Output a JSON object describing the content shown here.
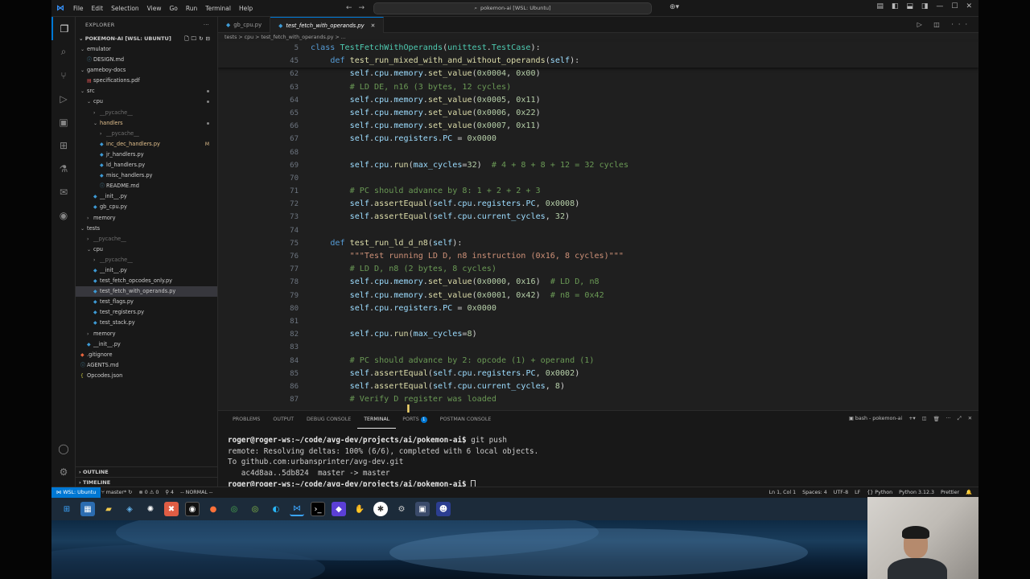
{
  "window": {
    "menu": [
      "File",
      "Edit",
      "Selection",
      "View",
      "Go",
      "Run",
      "Terminal",
      "Help"
    ],
    "command_center": "pokemon-ai [WSL: Ubuntu]"
  },
  "explorer": {
    "title": "EXPLORER",
    "root": "POKEMON-AI [WSL: UBUNTU]",
    "tree": [
      {
        "label": "emulator",
        "depth": 0,
        "type": "folder-open"
      },
      {
        "label": "DESIGN.md",
        "depth": 1,
        "type": "md"
      },
      {
        "label": "gameboy-docs",
        "depth": 0,
        "type": "folder-open"
      },
      {
        "label": "specifications.pdf",
        "depth": 1,
        "type": "pdf"
      },
      {
        "label": "src",
        "depth": 0,
        "type": "folder-open",
        "dot": true
      },
      {
        "label": "cpu",
        "depth": 1,
        "type": "folder-open",
        "dot": true
      },
      {
        "label": "__pycache__",
        "depth": 2,
        "type": "folder",
        "dim": true
      },
      {
        "label": "handlers",
        "depth": 2,
        "type": "folder-open",
        "mod": true,
        "dot": true
      },
      {
        "label": "__pycache__",
        "depth": 3,
        "type": "folder",
        "dim": true
      },
      {
        "label": "inc_dec_handlers.py",
        "depth": 3,
        "type": "py",
        "mod": true,
        "badge": "M"
      },
      {
        "label": "jr_handlers.py",
        "depth": 3,
        "type": "py"
      },
      {
        "label": "ld_handlers.py",
        "depth": 3,
        "type": "py"
      },
      {
        "label": "misc_handlers.py",
        "depth": 3,
        "type": "py"
      },
      {
        "label": "README.md",
        "depth": 3,
        "type": "md"
      },
      {
        "label": "__init__.py",
        "depth": 2,
        "type": "py"
      },
      {
        "label": "gb_cpu.py",
        "depth": 2,
        "type": "py"
      },
      {
        "label": "memory",
        "depth": 1,
        "type": "folder"
      },
      {
        "label": "tests",
        "depth": 0,
        "type": "folder-open"
      },
      {
        "label": "__pycache__",
        "depth": 1,
        "type": "folder",
        "dim": true
      },
      {
        "label": "cpu",
        "depth": 1,
        "type": "folder-open"
      },
      {
        "label": "__pycache__",
        "depth": 2,
        "type": "folder",
        "dim": true
      },
      {
        "label": "__init__.py",
        "depth": 2,
        "type": "py"
      },
      {
        "label": "test_fetch_opcodes_only.py",
        "depth": 2,
        "type": "py"
      },
      {
        "label": "test_fetch_with_operands.py",
        "depth": 2,
        "type": "py",
        "selected": true
      },
      {
        "label": "test_flags.py",
        "depth": 2,
        "type": "py"
      },
      {
        "label": "test_registers.py",
        "depth": 2,
        "type": "py"
      },
      {
        "label": "test_stack.py",
        "depth": 2,
        "type": "py"
      },
      {
        "label": "memory",
        "depth": 1,
        "type": "folder"
      },
      {
        "label": "__init__.py",
        "depth": 1,
        "type": "py"
      },
      {
        "label": ".gitignore",
        "depth": 0,
        "type": "git"
      },
      {
        "label": "AGENTS.md",
        "depth": 0,
        "type": "md"
      },
      {
        "label": "Opcodes.json",
        "depth": 0,
        "type": "json"
      }
    ],
    "outline": "OUTLINE",
    "timeline": "TIMELINE"
  },
  "editor": {
    "tabs": [
      {
        "label": "gb_cpu.py",
        "active": false
      },
      {
        "label": "test_fetch_with_operands.py",
        "active": true
      }
    ],
    "breadcrumb": "tests > cpu > test_fetch_with_operands.py > ...",
    "sticky": [
      {
        "n": "5",
        "tokens": [
          [
            "kw",
            "class "
          ],
          [
            "cls",
            "TestFetchWithOperands"
          ],
          [
            "op",
            "("
          ],
          [
            "cls",
            "unittest"
          ],
          [
            "op",
            "."
          ],
          [
            "cls",
            "TestCase"
          ],
          [
            "op",
            "):"
          ]
        ]
      },
      {
        "n": "45",
        "tokens": [
          [
            "op",
            "    "
          ],
          [
            "kw",
            "def "
          ],
          [
            "fn",
            "test_run_mixed_with_and_without_operands"
          ],
          [
            "op",
            "("
          ],
          [
            "slf",
            "self"
          ],
          [
            "op",
            "):"
          ]
        ]
      }
    ],
    "lines": [
      {
        "n": "62",
        "tokens": [
          [
            "op",
            "        "
          ],
          [
            "slf",
            "self"
          ],
          [
            "op",
            "."
          ],
          [
            "var",
            "cpu"
          ],
          [
            "op",
            "."
          ],
          [
            "var",
            "memory"
          ],
          [
            "op",
            "."
          ],
          [
            "fn",
            "set_value"
          ],
          [
            "op",
            "("
          ],
          [
            "num",
            "0x0004"
          ],
          [
            "op",
            ", "
          ],
          [
            "num",
            "0x00"
          ],
          [
            "op",
            ")"
          ]
        ]
      },
      {
        "n": "63",
        "tokens": [
          [
            "cmt",
            "        # LD DE, n16 (3 bytes, 12 cycles)"
          ]
        ]
      },
      {
        "n": "64",
        "tokens": [
          [
            "op",
            "        "
          ],
          [
            "slf",
            "self"
          ],
          [
            "op",
            "."
          ],
          [
            "var",
            "cpu"
          ],
          [
            "op",
            "."
          ],
          [
            "var",
            "memory"
          ],
          [
            "op",
            "."
          ],
          [
            "fn",
            "set_value"
          ],
          [
            "op",
            "("
          ],
          [
            "num",
            "0x0005"
          ],
          [
            "op",
            ", "
          ],
          [
            "num",
            "0x11"
          ],
          [
            "op",
            ")"
          ]
        ]
      },
      {
        "n": "65",
        "tokens": [
          [
            "op",
            "        "
          ],
          [
            "slf",
            "self"
          ],
          [
            "op",
            "."
          ],
          [
            "var",
            "cpu"
          ],
          [
            "op",
            "."
          ],
          [
            "var",
            "memory"
          ],
          [
            "op",
            "."
          ],
          [
            "fn",
            "set_value"
          ],
          [
            "op",
            "("
          ],
          [
            "num",
            "0x0006"
          ],
          [
            "op",
            ", "
          ],
          [
            "num",
            "0x22"
          ],
          [
            "op",
            ")"
          ]
        ]
      },
      {
        "n": "66",
        "tokens": [
          [
            "op",
            "        "
          ],
          [
            "slf",
            "self"
          ],
          [
            "op",
            "."
          ],
          [
            "var",
            "cpu"
          ],
          [
            "op",
            "."
          ],
          [
            "var",
            "memory"
          ],
          [
            "op",
            "."
          ],
          [
            "fn",
            "set_value"
          ],
          [
            "op",
            "("
          ],
          [
            "num",
            "0x0007"
          ],
          [
            "op",
            ", "
          ],
          [
            "num",
            "0x11"
          ],
          [
            "op",
            ")"
          ]
        ]
      },
      {
        "n": "67",
        "tokens": [
          [
            "op",
            "        "
          ],
          [
            "slf",
            "self"
          ],
          [
            "op",
            "."
          ],
          [
            "var",
            "cpu"
          ],
          [
            "op",
            "."
          ],
          [
            "var",
            "registers"
          ],
          [
            "op",
            "."
          ],
          [
            "var",
            "PC"
          ],
          [
            "op",
            " = "
          ],
          [
            "num",
            "0x0000"
          ]
        ]
      },
      {
        "n": "68",
        "tokens": []
      },
      {
        "n": "69",
        "tokens": [
          [
            "op",
            "        "
          ],
          [
            "slf",
            "self"
          ],
          [
            "op",
            "."
          ],
          [
            "var",
            "cpu"
          ],
          [
            "op",
            "."
          ],
          [
            "fn",
            "run"
          ],
          [
            "op",
            "("
          ],
          [
            "prm",
            "max_cycles"
          ],
          [
            "op",
            "="
          ],
          [
            "num",
            "32"
          ],
          [
            "op",
            ")  "
          ],
          [
            "cmt",
            "# 4 + 8 + 8 + 12 = 32 cycles"
          ]
        ]
      },
      {
        "n": "70",
        "tokens": []
      },
      {
        "n": "71",
        "tokens": [
          [
            "cmt",
            "        # PC should advance by 8: 1 + 2 + 2 + 3"
          ]
        ]
      },
      {
        "n": "72",
        "tokens": [
          [
            "op",
            "        "
          ],
          [
            "slf",
            "self"
          ],
          [
            "op",
            "."
          ],
          [
            "fn",
            "assertEqual"
          ],
          [
            "op",
            "("
          ],
          [
            "slf",
            "self"
          ],
          [
            "op",
            "."
          ],
          [
            "var",
            "cpu"
          ],
          [
            "op",
            "."
          ],
          [
            "var",
            "registers"
          ],
          [
            "op",
            "."
          ],
          [
            "var",
            "PC"
          ],
          [
            "op",
            ", "
          ],
          [
            "num",
            "0x0008"
          ],
          [
            "op",
            ")"
          ]
        ]
      },
      {
        "n": "73",
        "tokens": [
          [
            "op",
            "        "
          ],
          [
            "slf",
            "self"
          ],
          [
            "op",
            "."
          ],
          [
            "fn",
            "assertEqual"
          ],
          [
            "op",
            "("
          ],
          [
            "slf",
            "self"
          ],
          [
            "op",
            "."
          ],
          [
            "var",
            "cpu"
          ],
          [
            "op",
            "."
          ],
          [
            "var",
            "current_cycles"
          ],
          [
            "op",
            ", "
          ],
          [
            "num",
            "32"
          ],
          [
            "op",
            ")"
          ]
        ]
      },
      {
        "n": "74",
        "tokens": []
      },
      {
        "n": "75",
        "tokens": [
          [
            "op",
            "    "
          ],
          [
            "kw",
            "def "
          ],
          [
            "fn",
            "test_run_ld_d_n8"
          ],
          [
            "op",
            "("
          ],
          [
            "slf",
            "self"
          ],
          [
            "op",
            "):"
          ]
        ]
      },
      {
        "n": "76",
        "tokens": [
          [
            "str",
            "        \"\"\"Test running LD D, n8 instruction (0x16, 8 cycles)\"\"\""
          ]
        ]
      },
      {
        "n": "77",
        "tokens": [
          [
            "cmt",
            "        # LD D, n8 (2 bytes, 8 cycles)"
          ]
        ]
      },
      {
        "n": "78",
        "tokens": [
          [
            "op",
            "        "
          ],
          [
            "slf",
            "self"
          ],
          [
            "op",
            "."
          ],
          [
            "var",
            "cpu"
          ],
          [
            "op",
            "."
          ],
          [
            "var",
            "memory"
          ],
          [
            "op",
            "."
          ],
          [
            "fn",
            "set_value"
          ],
          [
            "op",
            "("
          ],
          [
            "num",
            "0x0000"
          ],
          [
            "op",
            ", "
          ],
          [
            "num",
            "0x16"
          ],
          [
            "op",
            ")  "
          ],
          [
            "cmt",
            "# LD D, n8"
          ]
        ]
      },
      {
        "n": "79",
        "tokens": [
          [
            "op",
            "        "
          ],
          [
            "slf",
            "self"
          ],
          [
            "op",
            "."
          ],
          [
            "var",
            "cpu"
          ],
          [
            "op",
            "."
          ],
          [
            "var",
            "memory"
          ],
          [
            "op",
            "."
          ],
          [
            "fn",
            "set_value"
          ],
          [
            "op",
            "("
          ],
          [
            "num",
            "0x0001"
          ],
          [
            "op",
            ", "
          ],
          [
            "num",
            "0x42"
          ],
          [
            "op",
            ")  "
          ],
          [
            "cmt",
            "# n8 = 0x42"
          ]
        ]
      },
      {
        "n": "80",
        "tokens": [
          [
            "op",
            "        "
          ],
          [
            "slf",
            "self"
          ],
          [
            "op",
            "."
          ],
          [
            "var",
            "cpu"
          ],
          [
            "op",
            "."
          ],
          [
            "var",
            "registers"
          ],
          [
            "op",
            "."
          ],
          [
            "var",
            "PC"
          ],
          [
            "op",
            " = "
          ],
          [
            "num",
            "0x0000"
          ]
        ]
      },
      {
        "n": "81",
        "tokens": []
      },
      {
        "n": "82",
        "tokens": [
          [
            "op",
            "        "
          ],
          [
            "slf",
            "self"
          ],
          [
            "op",
            "."
          ],
          [
            "var",
            "cpu"
          ],
          [
            "op",
            "."
          ],
          [
            "fn",
            "run"
          ],
          [
            "op",
            "("
          ],
          [
            "prm",
            "max_cycles"
          ],
          [
            "op",
            "="
          ],
          [
            "num",
            "8"
          ],
          [
            "op",
            ")"
          ]
        ]
      },
      {
        "n": "83",
        "tokens": []
      },
      {
        "n": "84",
        "tokens": [
          [
            "cmt",
            "        # PC should advance by 2: opcode (1) + operand (1)"
          ]
        ]
      },
      {
        "n": "85",
        "tokens": [
          [
            "op",
            "        "
          ],
          [
            "slf",
            "self"
          ],
          [
            "op",
            "."
          ],
          [
            "fn",
            "assertEqual"
          ],
          [
            "op",
            "("
          ],
          [
            "slf",
            "self"
          ],
          [
            "op",
            "."
          ],
          [
            "var",
            "cpu"
          ],
          [
            "op",
            "."
          ],
          [
            "var",
            "registers"
          ],
          [
            "op",
            "."
          ],
          [
            "var",
            "PC"
          ],
          [
            "op",
            ", "
          ],
          [
            "num",
            "0x0002"
          ],
          [
            "op",
            ")"
          ]
        ]
      },
      {
        "n": "86",
        "tokens": [
          [
            "op",
            "        "
          ],
          [
            "slf",
            "self"
          ],
          [
            "op",
            "."
          ],
          [
            "fn",
            "assertEqual"
          ],
          [
            "op",
            "("
          ],
          [
            "slf",
            "self"
          ],
          [
            "op",
            "."
          ],
          [
            "var",
            "cpu"
          ],
          [
            "op",
            "."
          ],
          [
            "var",
            "current_cycles"
          ],
          [
            "op",
            ", "
          ],
          [
            "num",
            "8"
          ],
          [
            "op",
            ")"
          ]
        ]
      },
      {
        "n": "87",
        "tokens": [
          [
            "cmt",
            "        # Verify D register was loaded"
          ]
        ]
      }
    ]
  },
  "panel": {
    "tabs": [
      "PROBLEMS",
      "OUTPUT",
      "DEBUG CONSOLE",
      "TERMINAL",
      "PORTS",
      "POSTMAN CONSOLE"
    ],
    "active_tab": "TERMINAL",
    "ports_badge": "1",
    "terminal_name": "bash - pokemon-ai",
    "lines": [
      {
        "prompt": "roger@roger-ws:~/code/avg-dev/projects/ai/pokemon-ai$",
        "text": " git push"
      },
      {
        "prompt": "",
        "text": "remote: Resolving deltas: 100% (6/6), completed with 6 local objects."
      },
      {
        "prompt": "",
        "text": "To github.com:urbansprinter/avg-dev.git"
      },
      {
        "prompt": "",
        "text": "   ac4d8aa..5db824  master -> master"
      },
      {
        "prompt": "roger@roger-ws:~/code/avg-dev/projects/ai/pokemon-ai$",
        "text": " ",
        "cursor": true
      }
    ]
  },
  "statusbar": {
    "remote": "WSL: Ubuntu",
    "branch": "master*",
    "errors": "0",
    "warnings": "0",
    "ports": "4",
    "mode": "-- NORMAL --",
    "right": [
      "Ln 1, Col 1",
      "Spaces: 4",
      "UTF-8",
      "LF",
      "{} Python",
      "Python 3.12.3",
      "Prettier"
    ]
  },
  "colors": {
    "accent": "#0078d4",
    "modified": "#e2c08d"
  }
}
